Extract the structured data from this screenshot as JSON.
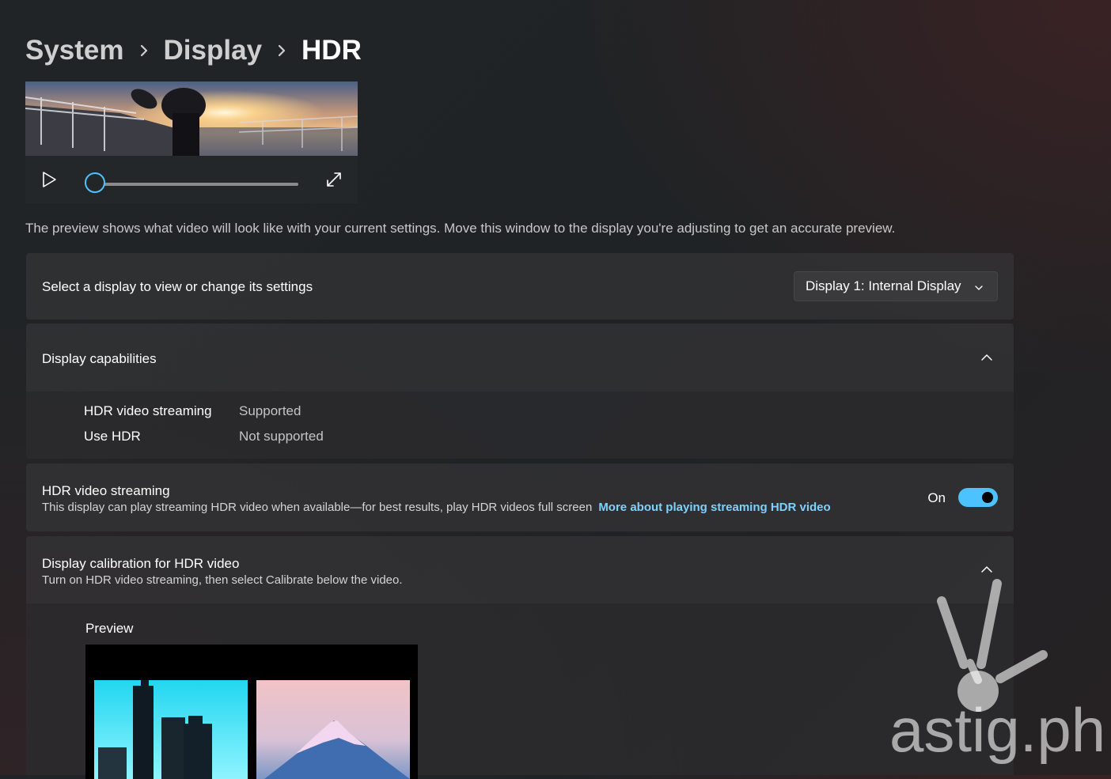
{
  "breadcrumb": {
    "level1": "System",
    "level2": "Display",
    "current": "HDR"
  },
  "video": {
    "play_icon": "play-icon",
    "fullscreen_icon": "expand-icon",
    "progress": 0
  },
  "description": "The preview shows what video will look like with your current settings. Move this window to the display you're adjusting to get an accurate preview.",
  "display_select": {
    "label": "Select a display to view or change its settings",
    "selected": "Display 1: Internal Display"
  },
  "capabilities": {
    "title": "Display capabilities",
    "items": [
      {
        "label": "HDR video streaming",
        "value": "Supported"
      },
      {
        "label": "Use HDR",
        "value": "Not supported"
      }
    ]
  },
  "hdr_streaming": {
    "title": "HDR video streaming",
    "subtitle": "This display can play streaming HDR video when available—for best results, play HDR videos full screen",
    "link": "More about playing streaming HDR video",
    "toggle_state": "On",
    "toggle_on": true
  },
  "calibration": {
    "title": "Display calibration for HDR video",
    "subtitle": "Turn on HDR video streaming, then select Calibrate below the video.",
    "preview_label": "Preview"
  },
  "watermark": {
    "text": "astig.ph"
  },
  "colors": {
    "accent": "#4cc2ff",
    "link": "#7ed0ff",
    "card": "#343436"
  }
}
